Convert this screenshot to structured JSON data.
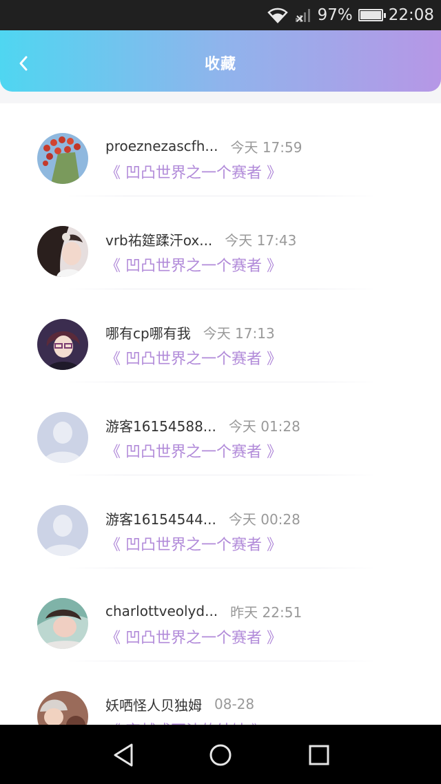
{
  "status_bar": {
    "battery": "97%",
    "time": "22:08"
  },
  "header": {
    "title": "收藏"
  },
  "favorites": [
    {
      "nickname": "proeznezascfh...",
      "time": "今天 17:59",
      "work": "《 凹凸世界之一个赛者 》"
    },
    {
      "nickname": "vrb祐筵蹂汗ox...",
      "time": "今天 17:43",
      "work": "《 凹凸世界之一个赛者 》"
    },
    {
      "nickname": "哪有cp哪有我",
      "time": "今天 17:13",
      "work": "《 凹凸世界之一个赛者 》"
    },
    {
      "nickname": "游客16154588...",
      "time": "今天 01:28",
      "work": "《 凹凸世界之一个赛者 》"
    },
    {
      "nickname": "游客16154544...",
      "time": "今天 00:28",
      "work": "《 凹凸世界之一个赛者 》"
    },
    {
      "nickname": "charlottveolyd...",
      "time": "昨天 22:51",
      "work": "《 凹凸世界之一个赛者 》"
    },
    {
      "nickname": "妖哂怪人贝独姆",
      "time": "08-28",
      "work": "《 穿越成百浊的结妹 》"
    }
  ],
  "colors": {
    "header_gradient_start": "#4fd6f1",
    "header_gradient_end": "#b697e6",
    "work_title": "#b18ad9"
  }
}
